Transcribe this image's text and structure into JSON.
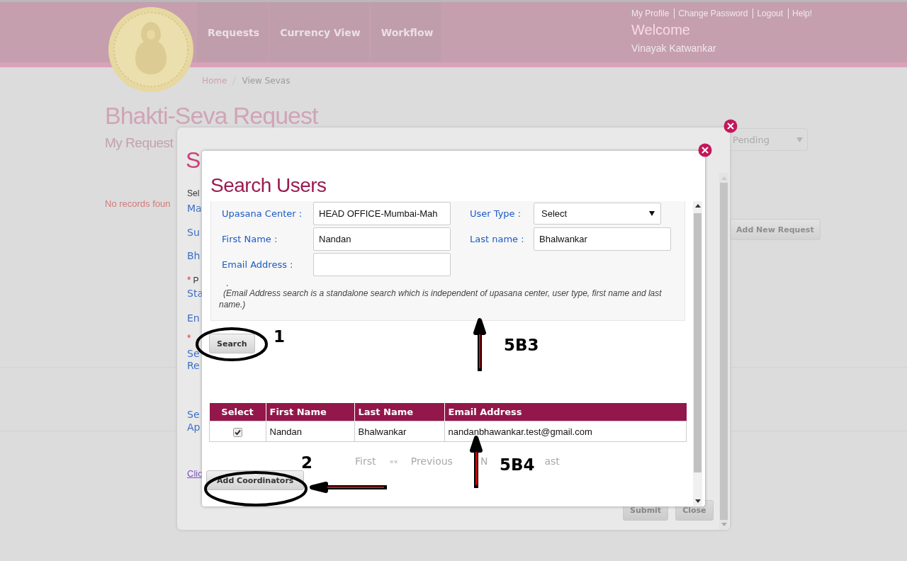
{
  "header": {
    "nav": [
      {
        "label": "Requests"
      },
      {
        "label": "Currency View"
      },
      {
        "label": "Workflow"
      }
    ],
    "user_links": [
      "My Profile",
      "Change Password",
      "Logout",
      "Help!"
    ],
    "welcome": "Welcome",
    "user_name": "Vinayak Katwankar"
  },
  "breadcrumb": [
    "Home",
    "View Sevas"
  ],
  "page": {
    "title": "Bhakti-Seva Request",
    "subtitle": "My Request",
    "empty_message": "No records foun",
    "status_filter": "Pending",
    "add_button": "Add New Request"
  },
  "request_dialog": {
    "heading": "S",
    "items": [
      {
        "kind": "note",
        "text": "Sel"
      },
      {
        "kind": "field",
        "text": "Ma"
      },
      {
        "kind": "field",
        "text": "Su"
      },
      {
        "kind": "field",
        "text": "Bh"
      },
      {
        "kind": "required",
        "mark": "*",
        "text": "P"
      },
      {
        "kind": "field",
        "text": "Sta"
      },
      {
        "kind": "field",
        "text": "En"
      },
      {
        "kind": "required",
        "mark": "*"
      },
      {
        "kind": "field",
        "text": "Se"
      },
      {
        "kind": "field",
        "text": "Re"
      },
      {
        "kind": "field",
        "text": "Se"
      },
      {
        "kind": "field",
        "text": "Ap"
      },
      {
        "kind": "link",
        "text": "Clic"
      }
    ],
    "buttons": [
      "Submit",
      "Close"
    ]
  },
  "search_dialog": {
    "title": "Search Users",
    "fields": [
      {
        "kind": "input",
        "label": "Upasana Center :",
        "value": "HEAD OFFICE-Mumbai-Mah"
      },
      {
        "kind": "select",
        "label": "User Type :",
        "value": "Select"
      },
      {
        "kind": "input",
        "label": "First Name :",
        "value": "Nandan"
      },
      {
        "kind": "input",
        "label": "Last name :",
        "value": "Bhalwankar"
      },
      {
        "kind": "input",
        "label": "Email Address :"
      }
    ],
    "note_mark": ".",
    "note": "(Email Address search is a standalone search which is independent of upasana center, user type, first name and last name.)",
    "search_button": "Search",
    "table": {
      "columns": [
        "Select",
        "First Name",
        "Last Name",
        "Email Address"
      ],
      "rows": [
        {
          "cells": [
            {
              "kind": "checkbox",
              "checked": true
            },
            "Nandan",
            "Bhalwankar",
            "nandanbhawankar.test@gmail.com"
          ]
        }
      ]
    },
    "pagination": [
      "First",
      "««",
      "Previous",
      "N",
      "ast"
    ],
    "add_button": "Add Coordinators"
  },
  "annotations": [
    {
      "label": "1"
    },
    {
      "label": "5B3"
    },
    {
      "label": "2"
    },
    {
      "label": "5B4"
    }
  ]
}
